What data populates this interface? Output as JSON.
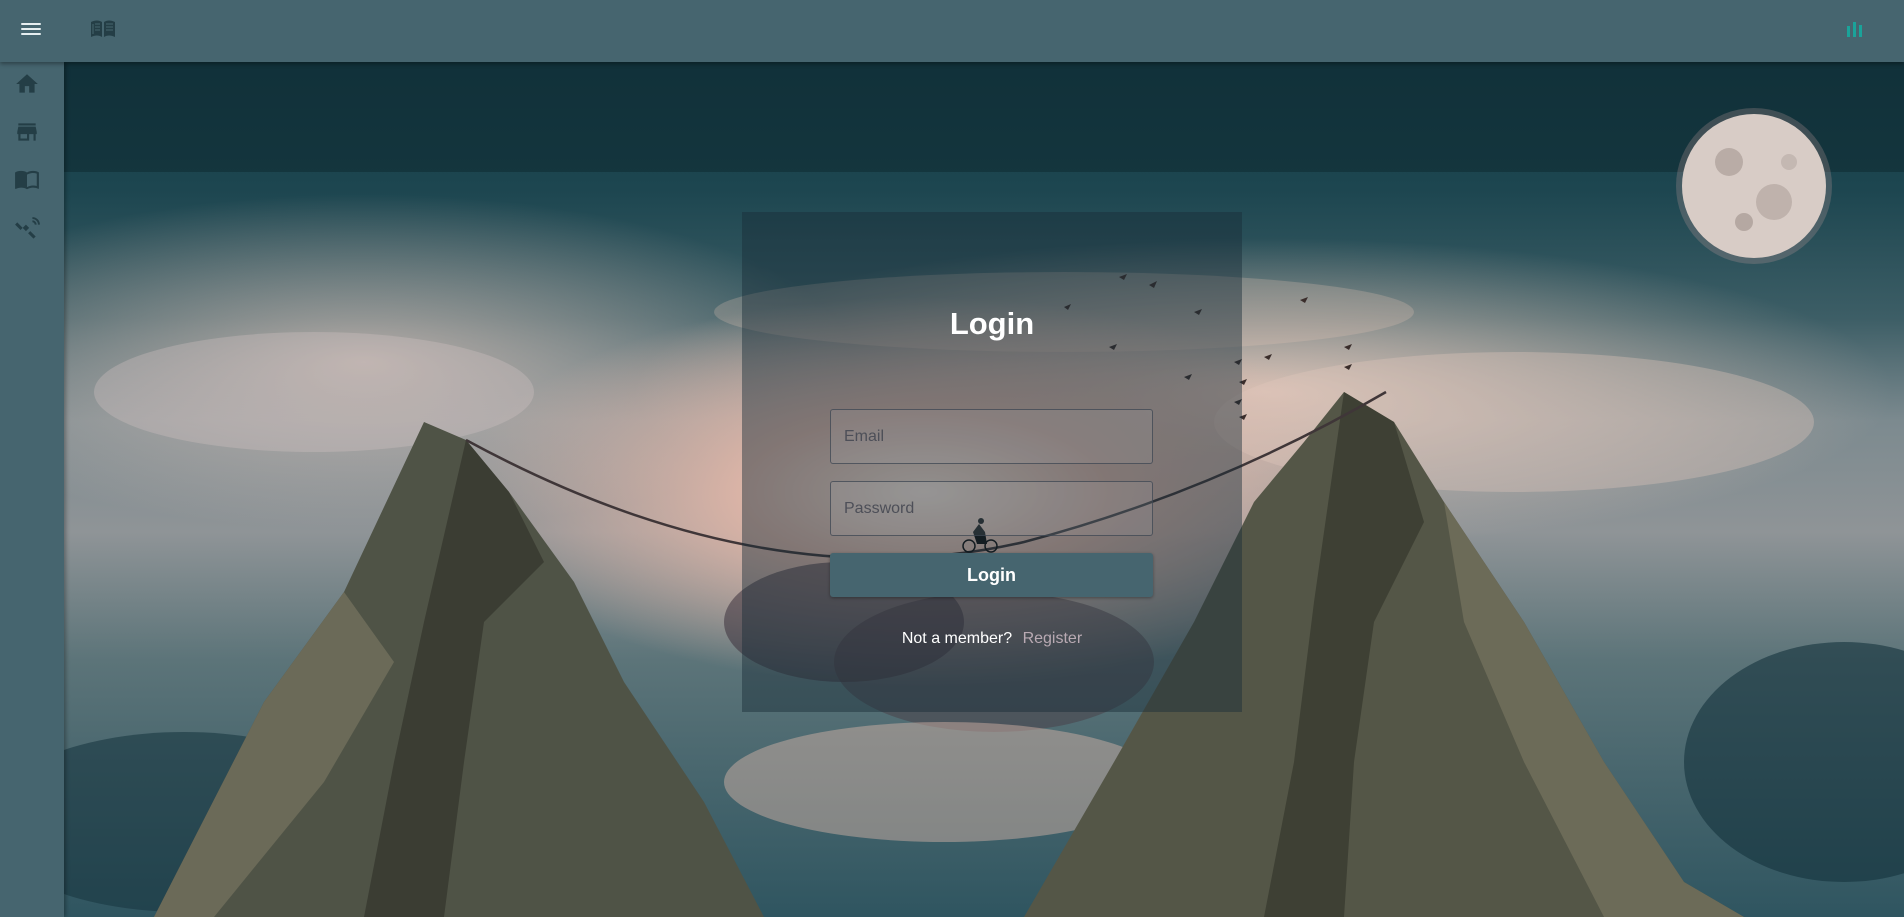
{
  "topbar": {
    "menu_icon": "menu-icon",
    "logo_icon": "open-book-icon",
    "right_icon": "equalizer-icon",
    "right_icon_color": "#1aa39a"
  },
  "sidebar": {
    "items": [
      {
        "icon": "home-icon"
      },
      {
        "icon": "store-icon"
      },
      {
        "icon": "book-icon"
      },
      {
        "icon": "satellite-icon"
      }
    ]
  },
  "login": {
    "title": "Login",
    "email_placeholder": "Email",
    "password_placeholder": "Password",
    "button_label": "Login",
    "not_member_text": "Not a member?",
    "register_label": "Register"
  },
  "colors": {
    "primary": "#46656f",
    "card_overlay": "rgba(25,45,55,0.45)",
    "link": "#b9aab3"
  }
}
